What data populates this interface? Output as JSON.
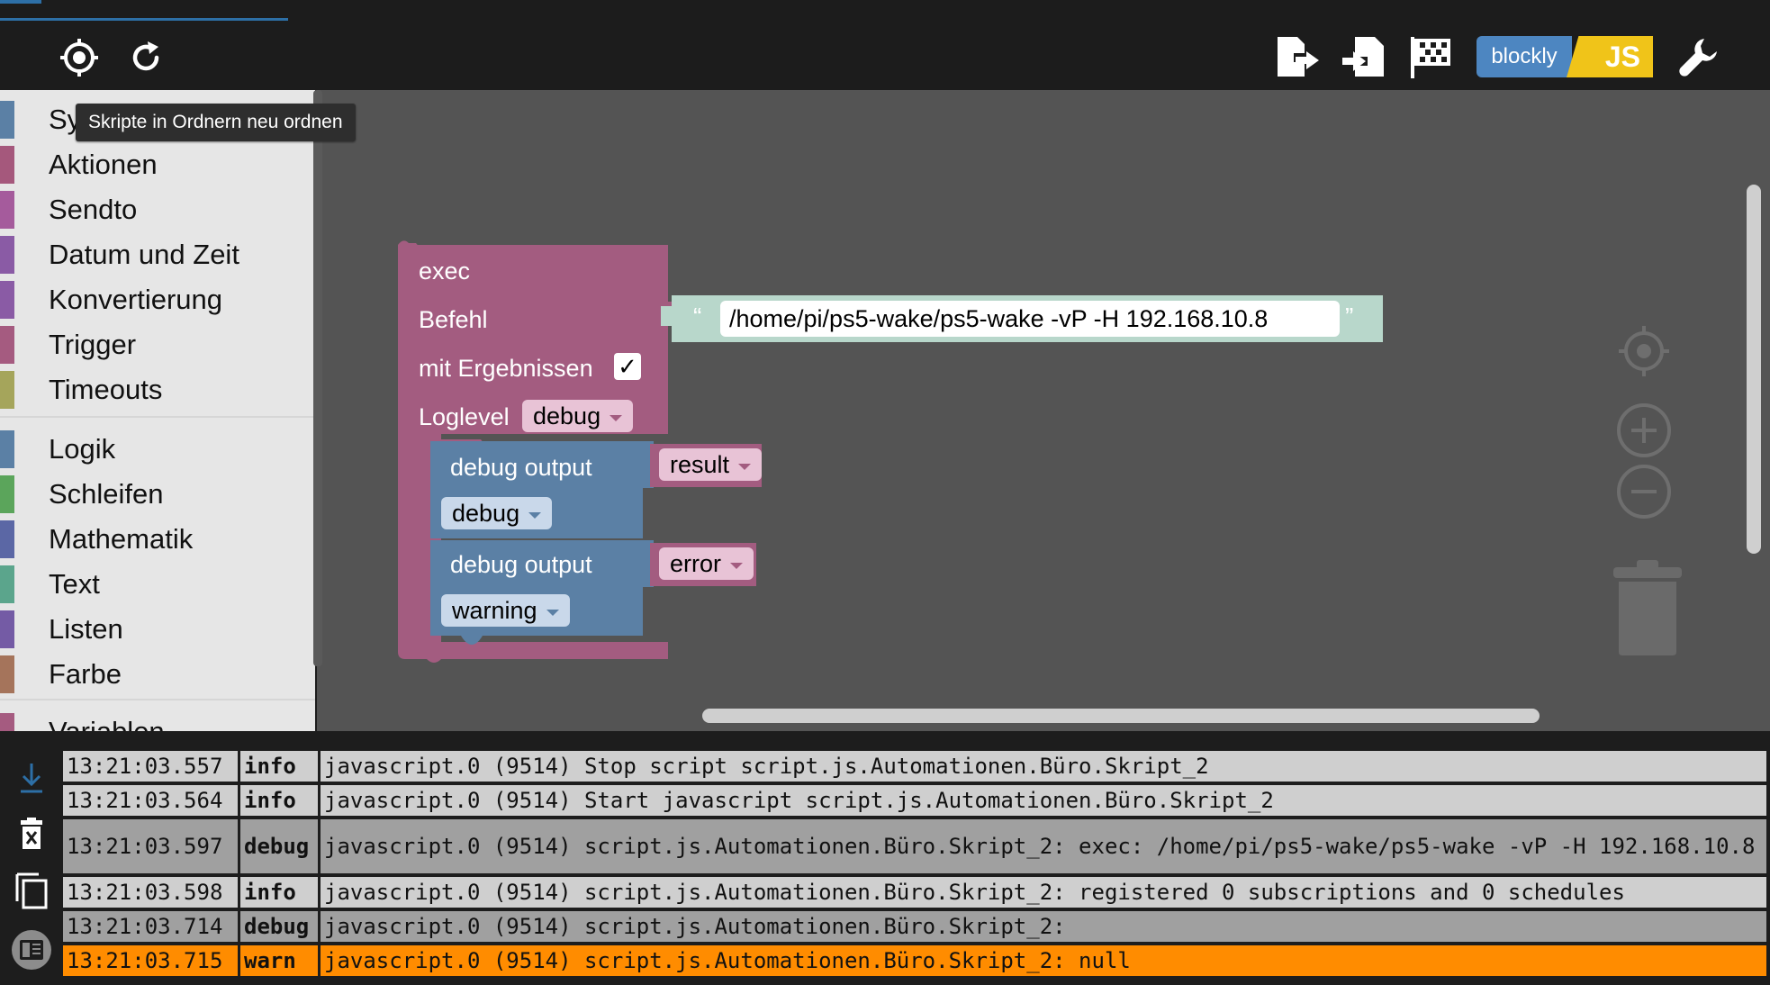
{
  "tooltip": "Skripte in Ordnern neu ordnen",
  "toolbar": {
    "blockly_label": "blockly",
    "js_label": "JS"
  },
  "toolbox": {
    "items": [
      {
        "label": "Sy",
        "color": "#5b80a5"
      },
      {
        "label": "Aktionen",
        "color": "#a5587c"
      },
      {
        "label": "Sendto",
        "color": "#a55b9c"
      },
      {
        "label": "Datum und Zeit",
        "color": "#8a5ba5"
      },
      {
        "label": "Konvertierung",
        "color": "#8a5ba5"
      },
      {
        "label": "Trigger",
        "color": "#a55b80"
      },
      {
        "label": "Timeouts",
        "color": "#a5a55b"
      },
      {
        "label": "Logik",
        "color": "#5b80a5"
      },
      {
        "label": "Schleifen",
        "color": "#5ba55b"
      },
      {
        "label": "Mathematik",
        "color": "#5b67a5"
      },
      {
        "label": "Text",
        "color": "#5ba58c"
      },
      {
        "label": "Listen",
        "color": "#745ba5"
      },
      {
        "label": "Farbe",
        "color": "#a5745b"
      },
      {
        "label": "Variablen",
        "color": "#a55b80"
      }
    ]
  },
  "blocks": {
    "exec": {
      "title": "exec",
      "befehl_label": "Befehl",
      "command": "/home/pi/ps5-wake/ps5-wake -vP -H 192.168.10.8",
      "quote_open": "“",
      "quote_close": "”",
      "mit_label": "mit Ergebnissen",
      "mit_checked": "✓",
      "loglevel_label": "Loglevel",
      "loglevel_value": "debug"
    },
    "debug1": {
      "label": "debug output",
      "var": "result",
      "level": "debug"
    },
    "debug2": {
      "label": "debug output",
      "var": "error",
      "level": "warning"
    }
  },
  "log": {
    "rows": [
      {
        "time": "13:21:03.557",
        "level": "info",
        "msg": "javascript.0 (9514) Stop script script.js.Automationen.Büro.Skript_2",
        "style": "normal"
      },
      {
        "time": "13:21:03.564",
        "level": "info",
        "msg": "javascript.0 (9514) Start javascript script.js.Automationen.Büro.Skript_2",
        "style": "normal"
      },
      {
        "time": "13:21:03.597",
        "level": "debug",
        "msg": "javascript.0 (9514) script.js.Automationen.Büro.Skript_2: exec: /home/pi/ps5-wake/ps5-wake -vP -H 192.168.10.8",
        "style": "dark"
      },
      {
        "time": "13:21:03.598",
        "level": "info",
        "msg": "javascript.0 (9514) script.js.Automationen.Büro.Skript_2: registered 0 subscriptions and 0 schedules",
        "style": "normal"
      },
      {
        "time": "13:21:03.714",
        "level": "debug",
        "msg": "javascript.0 (9514) script.js.Automationen.Büro.Skript_2:",
        "style": "dark"
      },
      {
        "time": "13:21:03.715",
        "level": "warn",
        "msg": "javascript.0 (9514) script.js.Automationen.Büro.Skript_2: null",
        "style": "warn"
      }
    ]
  }
}
